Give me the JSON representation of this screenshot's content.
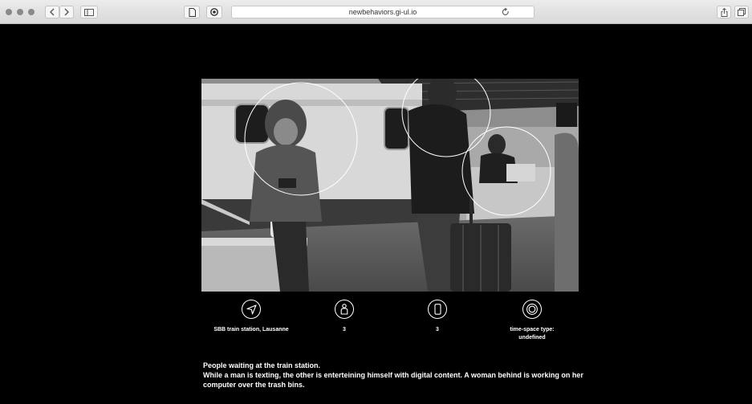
{
  "browser": {
    "url": "newbehaviors.gi-ul.io",
    "back_icon": "chevron-left-icon",
    "forward_icon": "chevron-right-icon",
    "sidebar_icon": "sidebar-icon",
    "reader_icon": "page-icon",
    "privacy_icon": "shield-icon",
    "reload_icon": "reload-icon",
    "share_icon": "share-icon",
    "tabs_icon": "tabs-icon"
  },
  "photo": {
    "description_icon": "black-and-white-photo"
  },
  "meta": [
    {
      "icon": "location-arrow-icon",
      "label": "SBB train station, Lausanne"
    },
    {
      "icon": "person-icon",
      "label": "3"
    },
    {
      "icon": "phone-icon",
      "label": "3"
    },
    {
      "icon": "target-icon",
      "label": "time-space type: undefined"
    }
  ],
  "caption": {
    "line1": "People waiting at the train station.",
    "line2": "While a man is texting, the other is enterteining himself with digital content. A woman behind is working on her computer over the trash bins."
  },
  "colors": {
    "background": "#000000",
    "text": "#ffffff",
    "toolbar": "#e4e4e4"
  }
}
